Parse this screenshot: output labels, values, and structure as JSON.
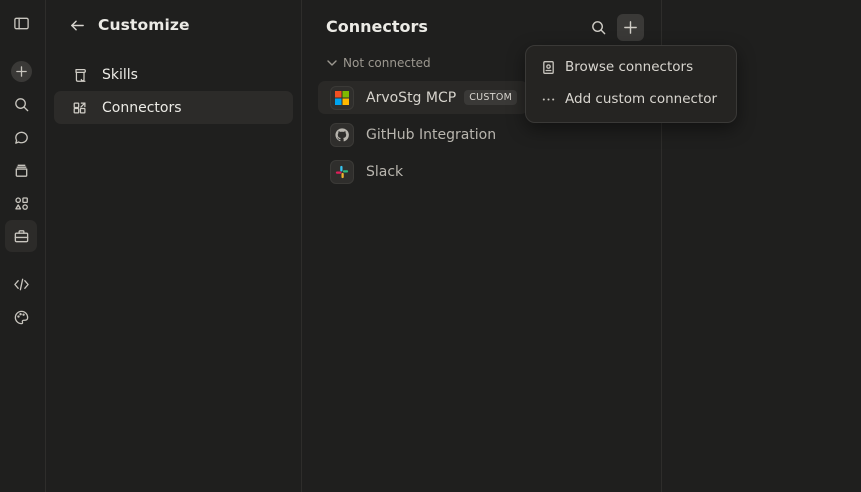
{
  "nav": {
    "title": "Customize",
    "items": [
      {
        "label": "Skills",
        "icon": "scroll-icon",
        "active": false
      },
      {
        "label": "Connectors",
        "icon": "connectors-icon",
        "active": true
      }
    ]
  },
  "connectors": {
    "title": "Connectors",
    "group_label": "Not connected",
    "items": [
      {
        "name": "ArvoStg MCP",
        "badge": "CUSTOM",
        "icon": "windows-logo-icon"
      },
      {
        "name": "GitHub Integration",
        "badge": "",
        "icon": "github-icon"
      },
      {
        "name": "Slack",
        "badge": "",
        "icon": "slack-icon"
      }
    ]
  },
  "add_menu": {
    "items": [
      {
        "label": "Browse connectors",
        "icon": "browse-icon"
      },
      {
        "label": "Add custom connector",
        "icon": "more-dots-icon"
      }
    ]
  },
  "rail": {
    "icons": [
      "sidebar-toggle-icon",
      "new-chat-icon",
      "search-icon",
      "chats-icon",
      "projects-icon",
      "artifacts-icon",
      "customize-icon",
      "code-icon",
      "palette-icon"
    ]
  }
}
